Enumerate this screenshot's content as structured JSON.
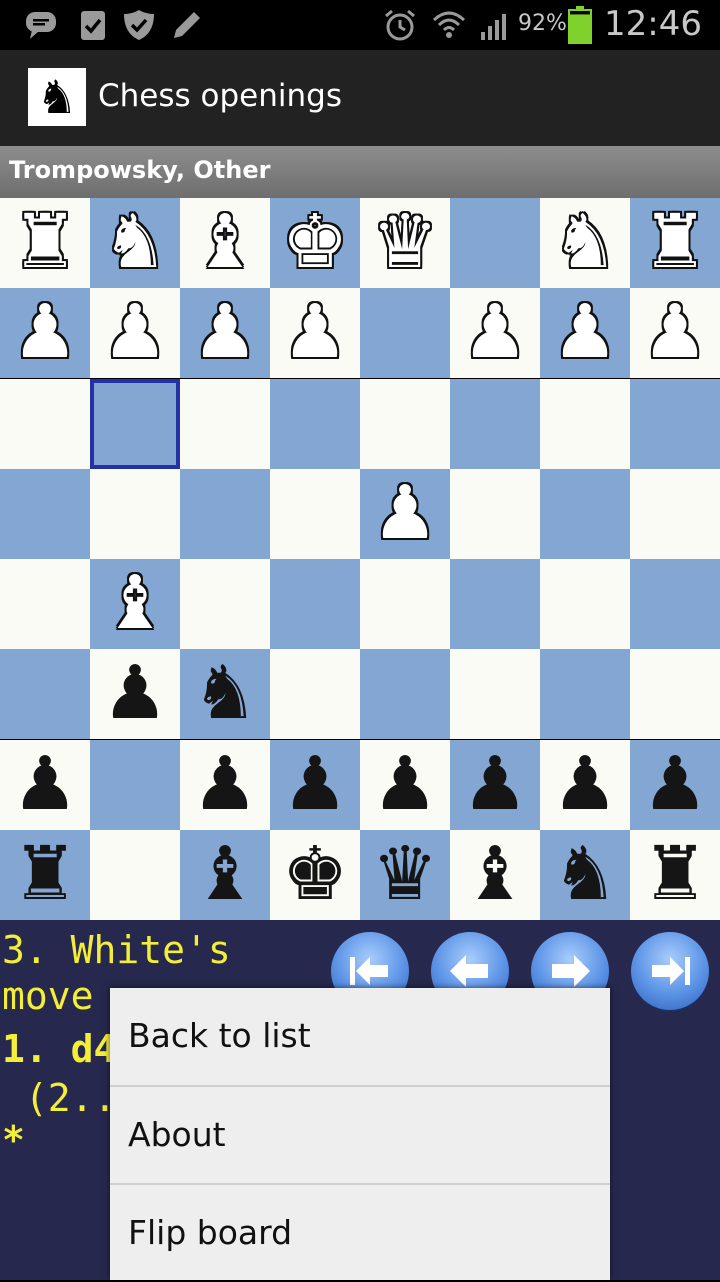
{
  "status_bar": {
    "notification_icons": [
      "chat-icon",
      "clipboard-check-icon",
      "shield-check-icon",
      "pencil-icon"
    ],
    "system_icons": [
      "alarm-icon",
      "wifi-icon",
      "signal-icon"
    ],
    "battery_percent": "92%",
    "battery_level": 0.92,
    "time": "12:46"
  },
  "action_bar": {
    "icon": "knight-icon",
    "title": "Chess openings"
  },
  "opening": {
    "name": "Trompowsky, Other"
  },
  "board": {
    "light_color": "#fbfbf5",
    "dark_color": "#84a6d3",
    "highlight_color": "#2432a8",
    "highlighted_square": "b3",
    "ranks": [
      [
        "wR",
        "wN",
        "wB",
        "wK",
        "wQ",
        "",
        "wN",
        "wR"
      ],
      [
        "wP",
        "wP",
        "wP",
        "wP",
        "",
        "wP",
        "wP",
        "wP"
      ],
      [
        "",
        "",
        "",
        "",
        "",
        "",
        "",
        ""
      ],
      [
        "",
        "",
        "",
        "",
        "wP",
        "",
        "",
        ""
      ],
      [
        "",
        "wB",
        "",
        "",
        "",
        "",
        "",
        ""
      ],
      [
        "",
        "bP",
        "bN",
        "",
        "",
        "",
        "",
        ""
      ],
      [
        "bP",
        "",
        "bP",
        "bP",
        "bP",
        "bP",
        "bP",
        "bP"
      ],
      [
        "bR",
        "",
        "bB",
        "bK",
        "bQ",
        "bB",
        "bN",
        "bR"
      ]
    ]
  },
  "moves": {
    "line1": "3. White's",
    "line2": "move",
    "line3": "1. d4",
    "line4": " (2..",
    "line5": "*"
  },
  "nav_buttons": [
    "first-move-icon",
    "previous-move-icon",
    "next-move-icon",
    "last-move-icon"
  ],
  "menu": {
    "items": [
      "Back to list",
      "About",
      "Flip board"
    ]
  }
}
